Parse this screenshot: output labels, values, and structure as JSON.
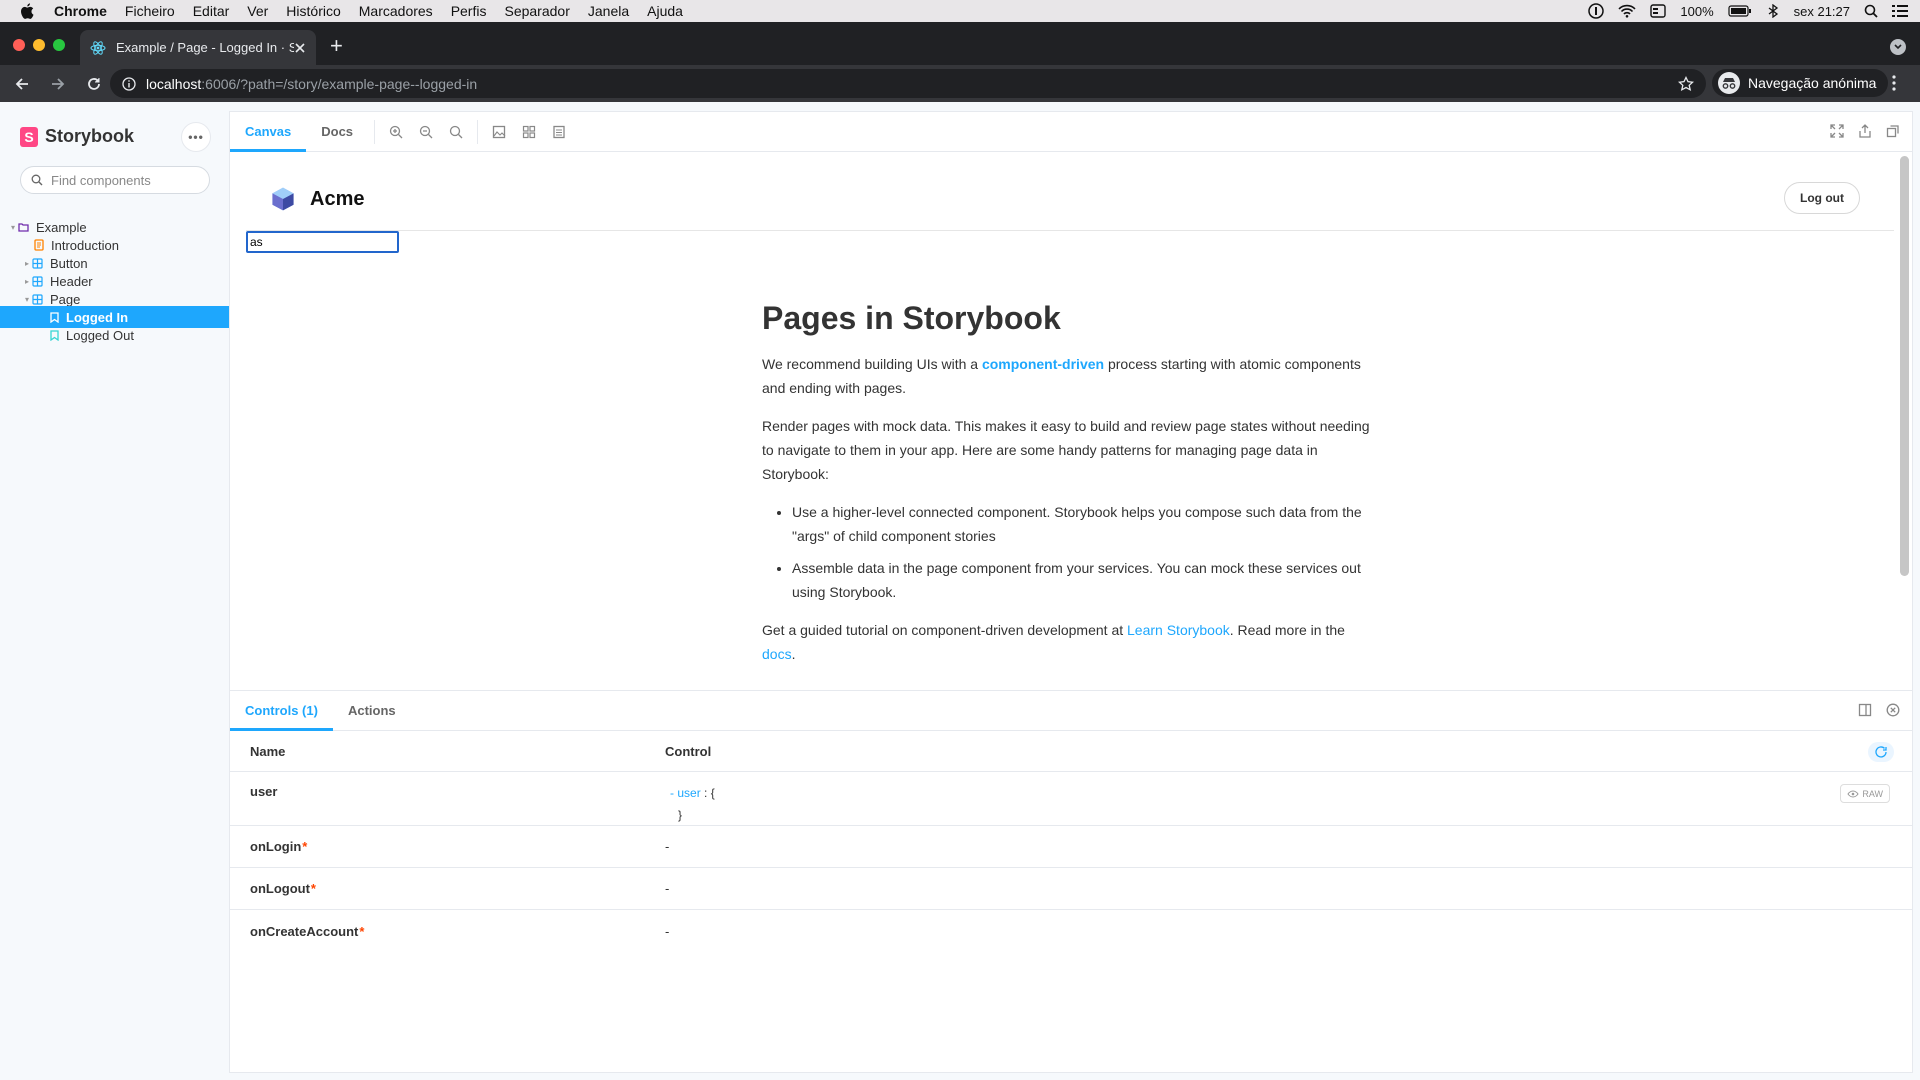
{
  "menubar": {
    "app": "Chrome",
    "items": [
      "Ficheiro",
      "Editar",
      "Ver",
      "Histórico",
      "Marcadores",
      "Perfis",
      "Separador",
      "Janela",
      "Ajuda"
    ],
    "battery": "100%",
    "clock": "sex 21:27"
  },
  "browser": {
    "tab_title": "Example / Page - Logged In · Storybook",
    "url_host": "localhost",
    "url_path": ":6006/?path=/story/example-page--logged-in",
    "profile_label": "Navegação anónima"
  },
  "sidebar": {
    "brand": "Storybook",
    "search_placeholder": "Find components",
    "tree": [
      {
        "label": "Example",
        "kind": "group"
      },
      {
        "label": "Introduction",
        "kind": "doc"
      },
      {
        "label": "Button",
        "kind": "component"
      },
      {
        "label": "Header",
        "kind": "component"
      },
      {
        "label": "Page",
        "kind": "component"
      },
      {
        "label": "Logged In",
        "kind": "story",
        "selected": true
      },
      {
        "label": "Logged Out",
        "kind": "story"
      }
    ]
  },
  "main": {
    "tabs": [
      "Canvas",
      "Docs"
    ],
    "active_tab": "Canvas"
  },
  "preview": {
    "brand": "Acme",
    "logout_label": "Log out",
    "typed_value": "as",
    "heading": "Pages in Storybook",
    "p1_before": "We recommend building UIs with a ",
    "p1_link": "component-driven",
    "p1_after": " process starting with atomic components and ending with pages.",
    "p2": "Render pages with mock data. This makes it easy to build and review page states without needing to navigate to them in your app. Here are some handy patterns for managing page data in Storybook:",
    "bullets": [
      "Use a higher-level connected component. Storybook helps you compose such data from the \"args\" of child component stories",
      "Assemble data in the page component from your services. You can mock these services out using Storybook."
    ],
    "p3_before": "Get a guided tutorial on component-driven development at ",
    "p3_link1": "Learn Storybook",
    "p3_mid": ". Read more in the ",
    "p3_link2": "docs",
    "p3_after": "."
  },
  "addons": {
    "tabs": [
      "Controls (1)",
      "Actions"
    ],
    "active_tab": "Controls (1)",
    "col_name": "Name",
    "col_control": "Control",
    "raw_label": "RAW",
    "rows": [
      {
        "name": "user",
        "required": false,
        "obj_toggle": "-",
        "obj_key": "user",
        "obj_open": ": {",
        "obj_close": "}"
      },
      {
        "name": "onLogin",
        "required": true,
        "control": "-"
      },
      {
        "name": "onLogout",
        "required": true,
        "control": "-"
      },
      {
        "name": "onCreateAccount",
        "required": true,
        "control": "-"
      }
    ],
    "required_mark": "*"
  },
  "colors": {
    "accent": "#1ea7fd",
    "brand_pink": "#ff4785",
    "required": "#ff4400"
  }
}
